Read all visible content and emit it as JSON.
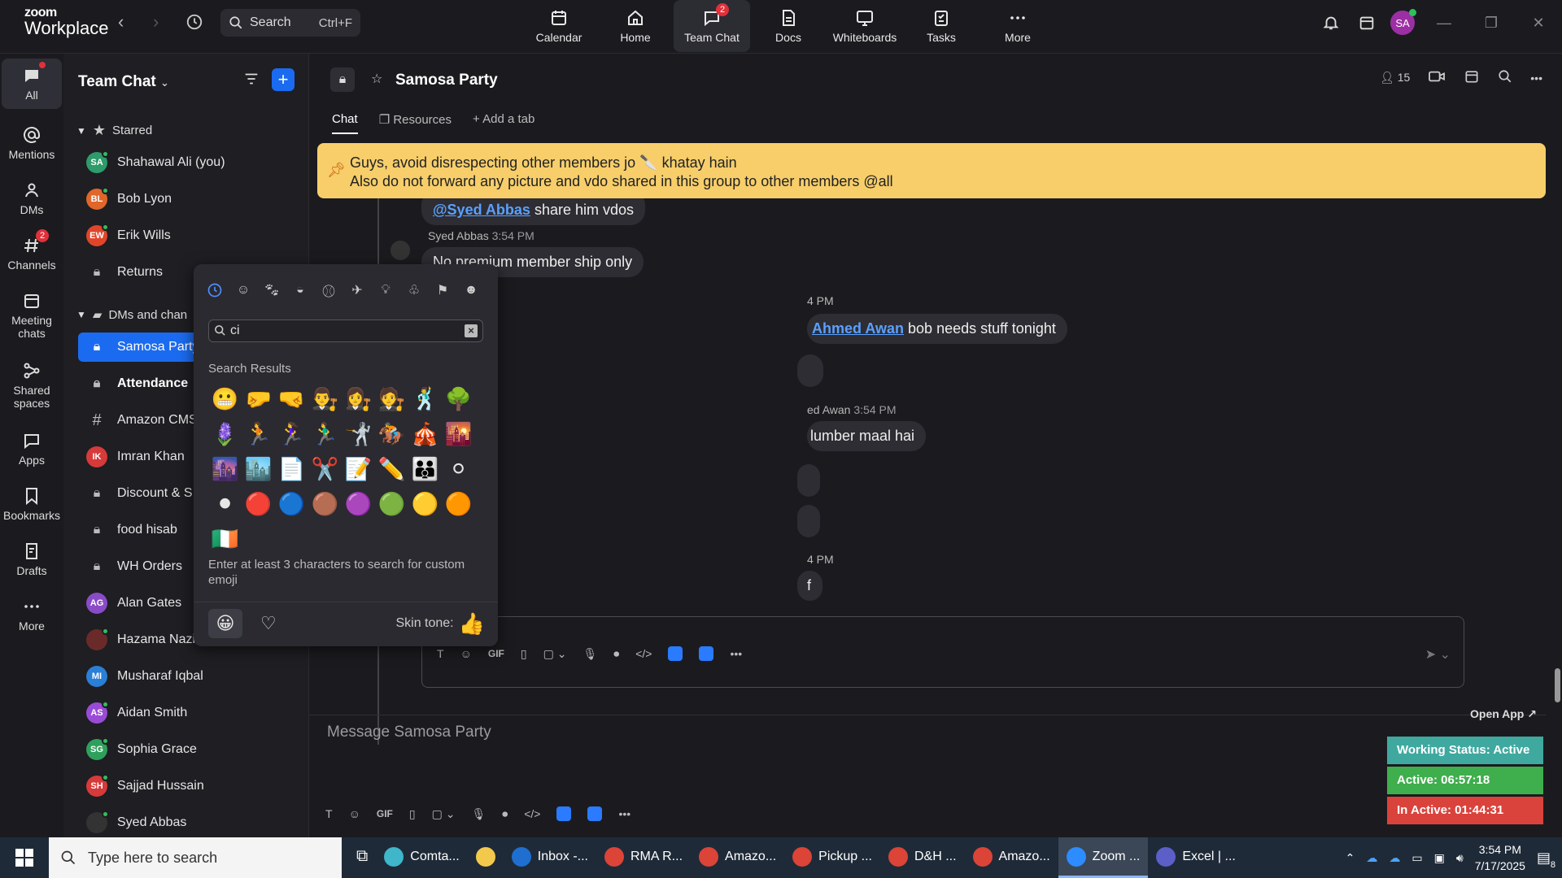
{
  "app": {
    "logo_line1": "zoom",
    "logo_line2": "Workplace"
  },
  "topbar": {
    "search_label": "Search",
    "search_shortcut": "Ctrl+F",
    "nav": [
      {
        "label": "Calendar",
        "icon": "calendar-icon"
      },
      {
        "label": "Home",
        "icon": "home-icon"
      },
      {
        "label": "Team Chat",
        "icon": "chat-icon",
        "badge": "2"
      },
      {
        "label": "Docs",
        "icon": "docs-icon"
      },
      {
        "label": "Whiteboards",
        "icon": "whiteboard-icon"
      },
      {
        "label": "Tasks",
        "icon": "tasks-icon"
      },
      {
        "label": "More",
        "icon": "more-icon"
      }
    ],
    "avatar_initials": "SA"
  },
  "rail": [
    {
      "label": "All"
    },
    {
      "label": "Mentions"
    },
    {
      "label": "DMs"
    },
    {
      "label": "Channels",
      "badge": "2"
    },
    {
      "label": "Meeting chats"
    },
    {
      "label": "Shared spaces"
    },
    {
      "label": "Apps"
    },
    {
      "label": "Bookmarks"
    },
    {
      "label": "Drafts"
    },
    {
      "label": "More"
    }
  ],
  "sidebar": {
    "title": "Team Chat",
    "starred_label": "Starred",
    "dms_label": "DMs and chan",
    "items": [
      {
        "initials": "SA",
        "name": "Shahawal Ali (you)",
        "color": "#2e9b6a"
      },
      {
        "initials": "BL",
        "name": "Bob Lyon",
        "color": "#e0662a"
      },
      {
        "initials": "EW",
        "name": "Erik Wills",
        "color": "#e0452a"
      },
      {
        "name": "Returns",
        "type": "lock"
      },
      {
        "name": "Samosa Party",
        "type": "lock",
        "selected": true
      },
      {
        "name": "Attendance",
        "type": "lock",
        "bold": true
      },
      {
        "name": "Amazon CMS",
        "type": "hash"
      },
      {
        "initials": "IK",
        "name": "Imran Khan",
        "color": "#d63a3a"
      },
      {
        "name": "Discount & S",
        "type": "lock"
      },
      {
        "name": "food hisab",
        "type": "lock"
      },
      {
        "name": "WH Orders",
        "type": "lock"
      },
      {
        "initials": "AG",
        "name": "Alan Gates",
        "color": "#8a4bc7"
      },
      {
        "initials": "",
        "name": "Hazama Nazir",
        "color": "#6b2a2a"
      },
      {
        "initials": "MI",
        "name": "Musharaf Iqbal",
        "color": "#2a7fd6"
      },
      {
        "initials": "AS",
        "name": "Aidan Smith",
        "color": "#9a4bd6"
      },
      {
        "initials": "SG",
        "name": "Sophia Grace",
        "color": "#2ea05b"
      },
      {
        "initials": "SH",
        "name": "Sajjad Hussain",
        "color": "#d63a3a"
      },
      {
        "initials": "",
        "name": "Syed Abbas",
        "color": "#333"
      }
    ]
  },
  "channel": {
    "name": "Samosa Party",
    "member_count": "15",
    "tabs": [
      "Chat",
      "Resources",
      "Add a tab"
    ],
    "pinned_line1": "Guys, avoid disrespecting other members jo 🔪 khatay hain",
    "pinned_line2": "Also do not forward any picture and vdo shared in this group to other members @all",
    "messages": {
      "partial_top": "share him vdos",
      "partial_top_mention": "@Syed Abbas",
      "sender1": "Syed Abbas",
      "time1": "3:54 PM",
      "msg1": "No premium member ship only",
      "time2": "4 PM",
      "mention2": "Ahmed Awan",
      "msg2": " bob needs stuff tonight",
      "sender3": "ed Awan",
      "time3": "3:54 PM",
      "msg3": "lumber maal hai",
      "time4": "4 PM",
      "msg4": "f"
    },
    "message_placeholder": "Message Samosa Party"
  },
  "emoji_picker": {
    "search_value": "ci",
    "results_label": "Search Results",
    "hint": "Enter at least 3 characters to search for custom emoji",
    "skin_label": "Skin tone:",
    "emojis": [
      "😬",
      "🤛",
      "🤜",
      "👨‍⚖️",
      "👩‍⚖️",
      "🧑‍⚖️",
      "🕺",
      "🌳",
      "🪻",
      "🏃",
      "🏃‍♀️",
      "🏃‍♂️",
      "🤺",
      "🏇",
      "🎪",
      "🌇",
      "🌆",
      "🏙️",
      "📄",
      "✂️",
      "📝",
      "✏️",
      "👪",
      "⚪",
      "⚫",
      "🔴",
      "🔵",
      "🟤",
      "🟣",
      "🟢",
      "🟡",
      "🟠",
      "🇮🇪"
    ]
  },
  "work_status": {
    "open_app": "Open App ↗",
    "status": "Working Status: Active",
    "active": "Active: 06:57:18",
    "inactive": "In Active: 01:44:31"
  },
  "taskbar": {
    "search_placeholder": "Type here to search",
    "apps": [
      {
        "label": "Comta...",
        "color": "#3fb6c9"
      },
      {
        "label": "",
        "color": "#f2c94c"
      },
      {
        "label": "Inbox -...",
        "color": "#1f6fd1"
      },
      {
        "label": "RMA R...",
        "color": "#db4437"
      },
      {
        "label": "Amazo...",
        "color": "#db4437"
      },
      {
        "label": "Pickup ...",
        "color": "#db4437"
      },
      {
        "label": "D&H ...",
        "color": "#db4437"
      },
      {
        "label": "Amazo...",
        "color": "#db4437"
      },
      {
        "label": "Zoom ...",
        "color": "#2d8cff",
        "active": true
      },
      {
        "label": "Excel | ...",
        "color": "#5b5fc7"
      }
    ],
    "time": "3:54 PM",
    "date": "7/17/2025",
    "notif_count": "8"
  }
}
